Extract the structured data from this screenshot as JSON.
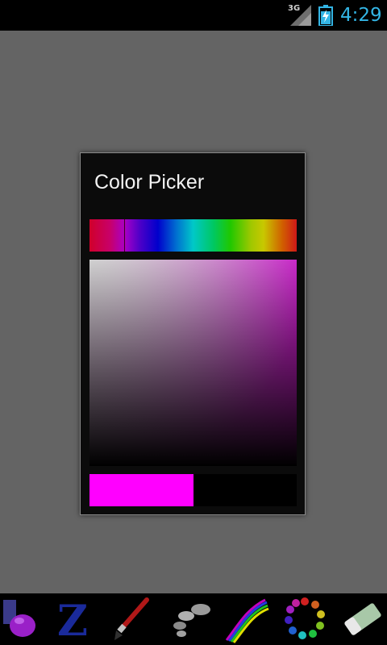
{
  "status_bar": {
    "network_type": "3G",
    "clock": "4:29",
    "icons": [
      "signal-icon",
      "battery-charging-icon"
    ],
    "accent_color": "#33b5e5"
  },
  "dialog": {
    "title": "Color Picker",
    "selected_color": "#ff00ff",
    "previous_color": "#000000"
  },
  "toolbar": {
    "tools": [
      {
        "icon": "ink-bottle-icon"
      },
      {
        "icon": "z-letter-icon"
      },
      {
        "icon": "paintbrush-icon"
      },
      {
        "icon": "stones-icon"
      },
      {
        "icon": "rainbow-curve-icon"
      },
      {
        "icon": "color-wheel-icon"
      },
      {
        "icon": "eraser-icon"
      }
    ]
  }
}
